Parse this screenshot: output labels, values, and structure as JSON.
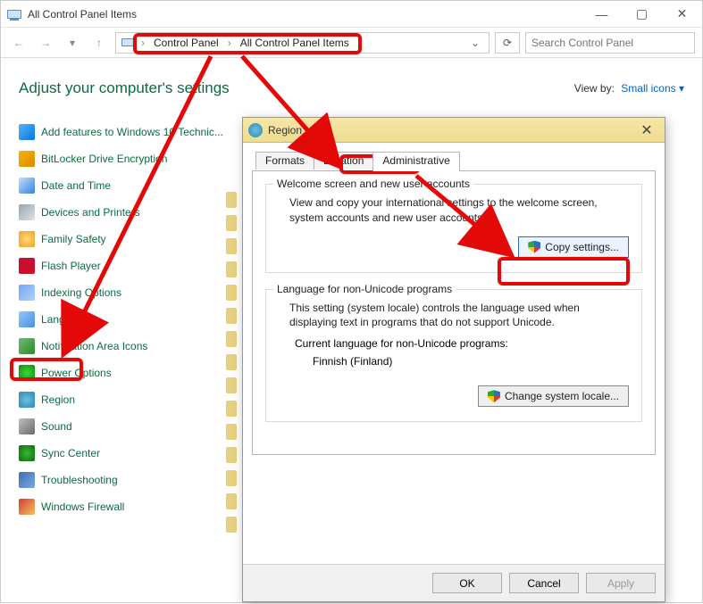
{
  "window": {
    "title": "All Control Panel Items",
    "breadcrumbs": [
      "Control Panel",
      "All Control Panel Items"
    ],
    "search_placeholder": "Search Control Panel"
  },
  "content": {
    "heading": "Adjust your computer's settings",
    "viewby_label": "View by:",
    "viewby_value": "Small icons"
  },
  "items": [
    {
      "label": "Add features to Windows 10 Technic...",
      "icon": "i-add"
    },
    {
      "label": "BitLocker Drive Encryption",
      "icon": "i-bit"
    },
    {
      "label": "Date and Time",
      "icon": "i-date"
    },
    {
      "label": "Devices and Printers",
      "icon": "i-dev"
    },
    {
      "label": "Family Safety",
      "icon": "i-fam"
    },
    {
      "label": "Flash Player",
      "icon": "i-flash"
    },
    {
      "label": "Indexing Options",
      "icon": "i-idx"
    },
    {
      "label": "Language",
      "icon": "i-lang"
    },
    {
      "label": "Notification Area Icons",
      "icon": "i-notif"
    },
    {
      "label": "Power Options",
      "icon": "i-power"
    },
    {
      "label": "Region",
      "icon": "i-region"
    },
    {
      "label": "Sound",
      "icon": "i-sound"
    },
    {
      "label": "Sync Center",
      "icon": "i-sync"
    },
    {
      "label": "Troubleshooting",
      "icon": "i-trouble"
    },
    {
      "label": "Windows Firewall",
      "icon": "i-fire"
    }
  ],
  "dialog": {
    "title": "Region",
    "tabs": [
      "Formats",
      "Location",
      "Administrative"
    ],
    "active_tab": "Administrative",
    "welcome": {
      "title": "Welcome screen and new user accounts",
      "desc": "View and copy your international settings to the welcome screen, system accounts and new user accounts.",
      "button": "Copy settings..."
    },
    "nonunicode": {
      "title": "Language for non-Unicode programs",
      "desc": "This setting (system locale) controls the language used when displaying text in programs that do not support Unicode.",
      "current_label": "Current language for non-Unicode programs:",
      "current_value": "Finnish (Finland)",
      "button": "Change system locale..."
    },
    "footer": {
      "ok": "OK",
      "cancel": "Cancel",
      "apply": "Apply"
    }
  }
}
